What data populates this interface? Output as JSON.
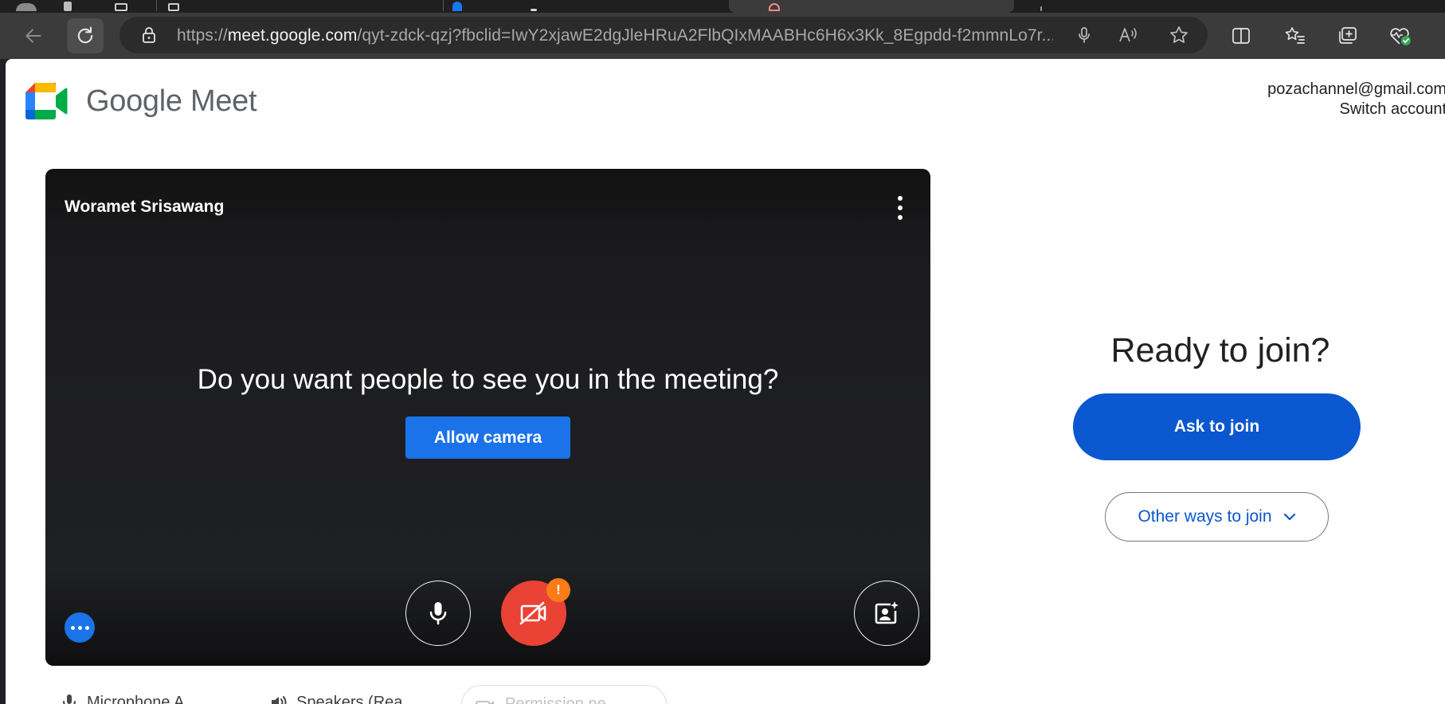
{
  "browser": {
    "url": {
      "scheme": "https://",
      "host": "meet.google.com",
      "path": "/qyt-zdck-qzj?fbclid=IwY2xjawE2dgJleHRuA2FlbQIxMAABHc6H6x3Kk_8Egpdd-f2mmnLo7r..."
    },
    "icons": {
      "back": "back-arrow-icon",
      "reload": "reload-icon",
      "lock": "lock-icon",
      "mic": "microphone-icon",
      "read_aloud": "read-aloud-icon",
      "favorite": "star-icon",
      "split_screen": "split-screen-icon",
      "favorites": "favorites-icon",
      "collections": "collections-icon",
      "health": "browser-essentials-icon"
    }
  },
  "header": {
    "logo_text": "Google Meet",
    "account_email": "pozachannel@gmail.com",
    "switch_account": "Switch account"
  },
  "preview": {
    "user_name": "Woramet Srisawang",
    "question": "Do you want people to see you in the meeting?",
    "allow_camera": "Allow camera",
    "camera_warning_badge": "!"
  },
  "devices": {
    "microphone": "Microphone A",
    "speakers": "Speakers (Rea",
    "camera": "Permission ne"
  },
  "join": {
    "heading": "Ready to join?",
    "ask_to_join": "Ask to join",
    "other_ways": "Other ways to join"
  },
  "colors": {
    "primary_blue": "#0b57d0",
    "allow_blue": "#1a73e8",
    "camera_off_red": "#ea4335",
    "warning_orange": "#fa7b17"
  }
}
